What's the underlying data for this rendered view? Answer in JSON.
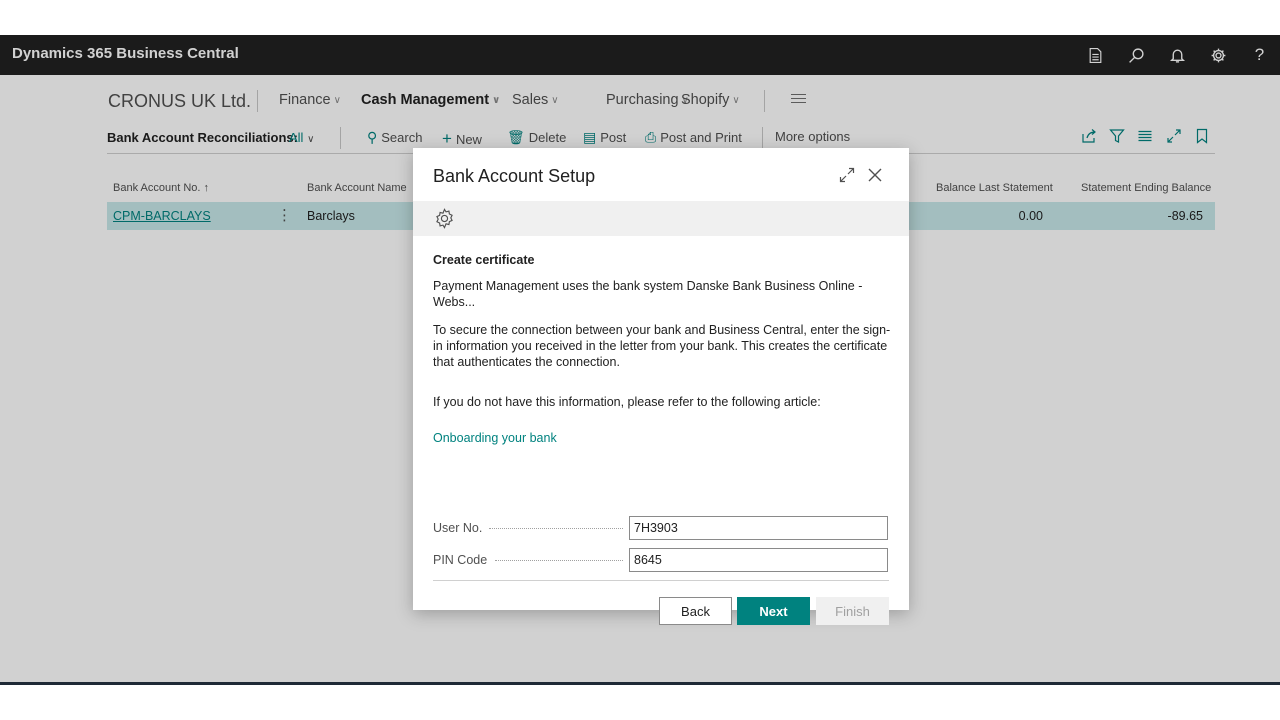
{
  "topbar": {
    "brand": "Dynamics 365 Business Central",
    "icons": [
      "document-icon",
      "search-icon",
      "bell-icon",
      "gear-icon",
      "help-icon"
    ]
  },
  "nav": {
    "company": "CRONUS UK Ltd.",
    "menus": [
      {
        "label": "Finance",
        "active": false
      },
      {
        "label": "Cash Management",
        "active": true
      },
      {
        "label": "Sales",
        "active": false
      },
      {
        "label": "Purchasing",
        "active": false
      },
      {
        "label": "Shopify",
        "active": false
      }
    ]
  },
  "actionbar": {
    "title": "Bank Account Reconciliations:",
    "filter": "All",
    "search": "Search",
    "new": "New",
    "delete": "Delete",
    "post": "Post",
    "post_and_print": "Post and Print",
    "more_options": "More options"
  },
  "list": {
    "columns": {
      "bank_account_no": "Bank Account No. ↑",
      "bank_account_name": "Bank Account Name",
      "balance_last_statement": "Balance Last Statement",
      "statement_ending_balance": "Statement Ending Balance"
    },
    "rows": [
      {
        "bank_account_no": "CPM-BARCLAYS",
        "bank_account_name": "Barclays",
        "balance_last_statement": "0.00",
        "statement_ending_balance": "-89.65"
      }
    ]
  },
  "dialog": {
    "title": "Bank Account Setup",
    "heading": "Create certificate",
    "intro": "Payment Management uses the bank system Danske Bank Business Online - Webs...",
    "body1": "To secure the connection between your bank and Business Central, enter the sign-in information you received in the letter from your bank. This creates the certificate that authenticates the connection.",
    "body2": "If you do not have this information, please refer to the following article:",
    "link": "Onboarding your bank",
    "user_no_label": "User No.",
    "user_no_value": "7H3903",
    "pin_label": "PIN Code",
    "pin_value": "8645",
    "back": "Back",
    "next": "Next",
    "finish": "Finish"
  },
  "colors": {
    "accent": "#00827f",
    "topbar": "#212121",
    "selected_row": "#c7e8ea"
  }
}
